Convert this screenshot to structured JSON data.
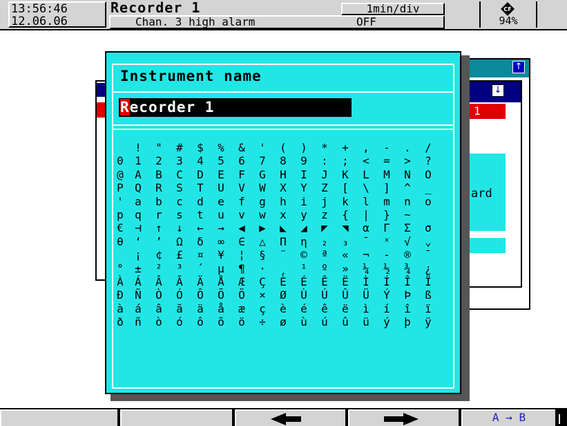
{
  "header": {
    "time": "13:56:46",
    "date": "12.06.06",
    "instrument_name": "Recorder 1",
    "rate": "1min/div",
    "message": "Chan. 3 high alarm",
    "message_state": "OFF",
    "status_percent": "94%",
    "status_icon": "cf-card-icon"
  },
  "background_window": {
    "value": "1",
    "text": "ard",
    "icon_up": "up-arrow-icon",
    "icon_down": "down-arrow-icon"
  },
  "dialog": {
    "title": "Instrument name",
    "input_first_char": "R",
    "input_rest": "ecorder 1",
    "char_rows": [
      [
        " ",
        "!",
        "\"",
        "#",
        "$",
        "%",
        "&",
        "'",
        "(",
        ")",
        "*",
        "+",
        ",",
        "-",
        ".",
        "/"
      ],
      [
        "0",
        "1",
        "2",
        "3",
        "4",
        "5",
        "6",
        "7",
        "8",
        "9",
        ":",
        ";",
        "<",
        "=",
        ">",
        "?"
      ],
      [
        "@",
        "A",
        "B",
        "C",
        "D",
        "E",
        "F",
        "G",
        "H",
        "I",
        "J",
        "K",
        "L",
        "M",
        "N",
        "O"
      ],
      [
        "P",
        "Q",
        "R",
        "S",
        "T",
        "U",
        "V",
        "W",
        "X",
        "Y",
        "Z",
        "[",
        "\\",
        "]",
        "^",
        "_"
      ],
      [
        "'",
        "a",
        "b",
        "c",
        "d",
        "e",
        "f",
        "g",
        "h",
        "i",
        "j",
        "k",
        "l",
        "m",
        "n",
        "o"
      ],
      [
        "p",
        "q",
        "r",
        "s",
        "t",
        "u",
        "v",
        "w",
        "x",
        "y",
        "z",
        "{",
        "|",
        "}",
        "~",
        ""
      ],
      [
        "€",
        "⊣",
        "↑",
        "↓",
        "←",
        "→",
        "◀",
        "▶",
        "◣",
        "◢",
        "◤",
        "◥",
        "α",
        "Γ",
        "Σ",
        "σ"
      ],
      [
        "θ",
        "‘",
        "’",
        "Ω",
        "δ",
        "∞",
        "∈",
        "△",
        "Π",
        "η",
        "₂",
        "₃",
        "ˉ",
        "ˣ",
        "√",
        "⌄"
      ],
      [
        " ",
        "¡",
        "¢",
        "£",
        "¤",
        "¥",
        "¦",
        "§",
        "¨",
        "©",
        "ª",
        "«",
        "¬",
        "-",
        "®",
        "¯"
      ],
      [
        "°",
        "±",
        "²",
        "³",
        "´",
        "µ",
        "¶",
        "·",
        "¸",
        "¹",
        "º",
        "»",
        "¼",
        "½",
        "¾",
        "¿"
      ],
      [
        "À",
        "Á",
        "Â",
        "Ã",
        "Ä",
        "Å",
        "Æ",
        "Ç",
        "È",
        "É",
        "Ê",
        "Ë",
        "Ì",
        "Í",
        "Î",
        "Ï"
      ],
      [
        "Ð",
        "Ñ",
        "Ò",
        "Ó",
        "Ô",
        "Õ",
        "Ö",
        "×",
        "Ø",
        "Ù",
        "Ú",
        "Û",
        "Ü",
        "Ý",
        "Þ",
        "ß"
      ],
      [
        "à",
        "á",
        "â",
        "ã",
        "ä",
        "å",
        "æ",
        "ç",
        "è",
        "é",
        "ê",
        "ë",
        "ì",
        "í",
        "î",
        "ï"
      ],
      [
        "ð",
        "ñ",
        "ò",
        "ó",
        "ô",
        "õ",
        "ö",
        "÷",
        "ø",
        "ù",
        "ú",
        "û",
        "ü",
        "ý",
        "þ",
        "ÿ"
      ]
    ]
  },
  "softkeys": {
    "key1": "",
    "key2": "",
    "key3_icon": "left-arrow-icon",
    "key4_icon": "right-arrow-icon",
    "key5": "A → B"
  },
  "colors": {
    "dialog_bg": "#22e6e6",
    "header_bg": "#d4d4d4",
    "caret": "#e00000",
    "key_text": "#2020c0"
  }
}
